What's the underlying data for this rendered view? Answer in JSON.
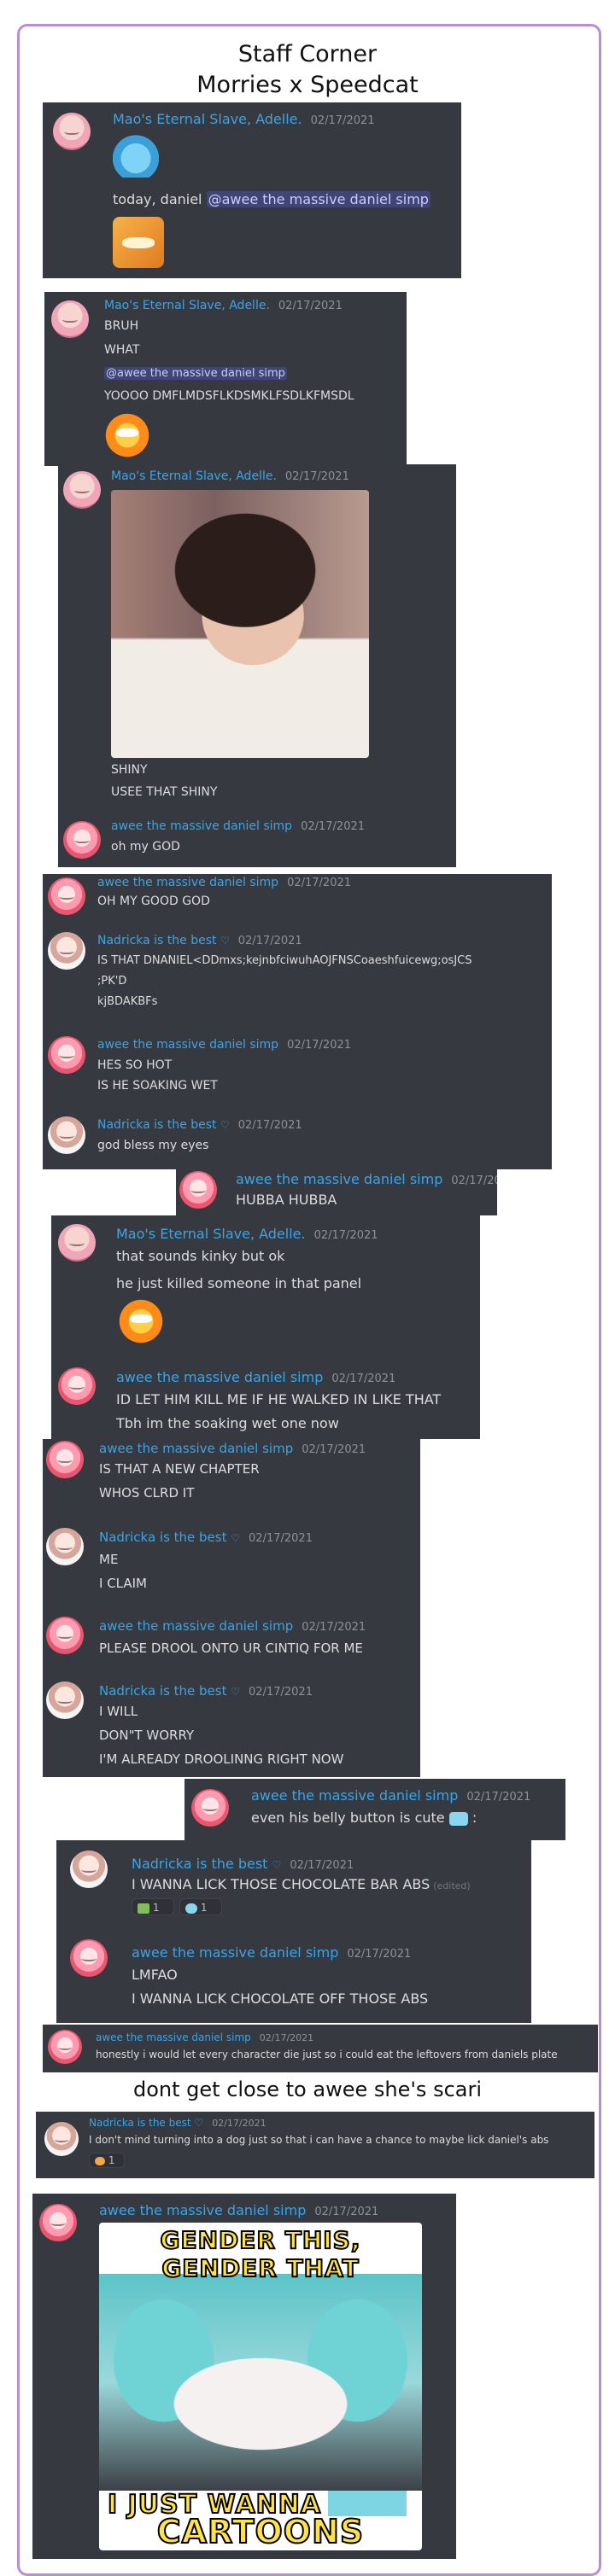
{
  "header": {
    "title": "Staff Corner",
    "subtitle": "Morries x Speedcat"
  },
  "caption": "dont get close to awee she's scari",
  "users": {
    "adelle": "Mao's Eternal Slave, Adelle.",
    "awee": "awee the massive daniel simp",
    "nad": "Nadricka is the best"
  },
  "date": "02/17/2021",
  "heart": "♡",
  "edited_label": "(edited)",
  "mention": "@awee the massive daniel simp",
  "blocks": {
    "b1": {
      "l1_prefix": "today, daniel "
    },
    "b2": {
      "l1": "BRUH",
      "l2": "WHAT",
      "l4": "YOOOO DMFLMDSFLKDSMKLFSDLKFMSDL"
    },
    "b3": {
      "l1": "SHINY",
      "l2": "USEE THAT SHINY",
      "reply": "oh my GOD"
    },
    "b4": {
      "m1": "OH MY GOOD GOD",
      "m2a": "IS THAT DNANIEL<DDmxs;kejnbfciwuhAOJFNSCoaeshfuicewg;osJCS",
      "m2b": ";PK'D",
      "m2c": "kjBDAKBFs",
      "m3a": "HES SO HOT",
      "m3b": "IS HE SOAKING WET",
      "m4": "god bless my eyes"
    },
    "b5": {
      "l1": "HUBBA HUBBA"
    },
    "b6": {
      "l1": "that sounds kinky but ok",
      "l2": "he just killed someone in that panel",
      "r1": "ID LET HIM KILL ME IF HE WALKED IN LIKE THAT",
      "r2": "Tbh im the soaking wet one now"
    },
    "b7": {
      "m1a": "IS THAT A NEW CHAPTER",
      "m1b": "WHOS CLRD IT",
      "m2a": "ME",
      "m2b": "I CLAIM",
      "m3": "PLEASE DROOL ONTO UR CINTIQ FOR ME",
      "m4a": "I WILL",
      "m4b": "DON\"T WORRY",
      "m4c": "I'M ALREADY DROOLINNG RIGHT NOW"
    },
    "b8": {
      "l1": "even his belly button is cute",
      "l1_suffix": ":"
    },
    "b9": {
      "l1": "I WANNA LICK THOSE CHOCOLATE BAR ABS",
      "react1": "1",
      "react2": "1",
      "r1": "LMFAO",
      "r2": "I WANNA LICK CHOCOLATE OFF THOSE ABS"
    },
    "b10": {
      "l1": "honestly i would let every character die just so i could eat the leftovers from daniels plate"
    },
    "b11": {
      "l1": "I don't mind turning into a dog just so that i can have a chance to maybe lick daniel's abs",
      "react": "1"
    },
    "b12": {
      "meme_top": "GENDER THIS, GENDER THAT",
      "meme_bottom_a": "I JUST WANNA",
      "meme_bottom_b": "CARTOONS"
    }
  },
  "colors": {
    "discord_bg": "#36393f",
    "name_blue": "#3ca4e6",
    "frame": "#b88fd6",
    "meme_text": "#ffe24a"
  },
  "icons": [
    "avatar-adelle",
    "avatar-awee",
    "avatar-nadricka",
    "blue-emoji",
    "cat-emoji",
    "orange-emoji",
    "heart-icon"
  ]
}
